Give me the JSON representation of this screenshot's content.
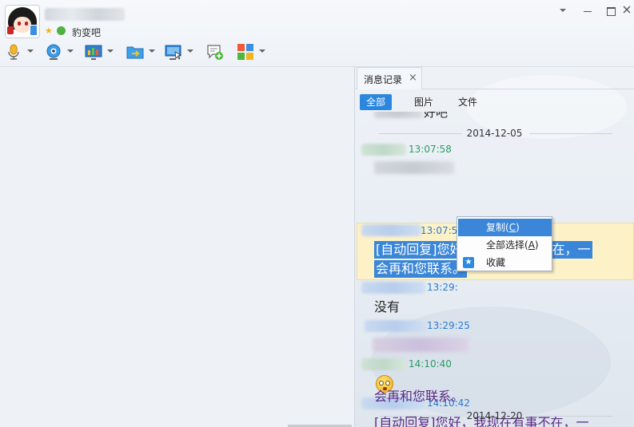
{
  "header": {
    "signature": "豹变吧",
    "icons": [
      "star-icon",
      "mood-icon"
    ],
    "window_controls": [
      "dropdown-icon",
      "minimize-icon",
      "maximize-icon",
      "close-icon"
    ]
  },
  "toolbar": {
    "tools": [
      "voice-call-icon",
      "video-call-icon",
      "screen-share-icon",
      "send-file-icon",
      "remote-assist-icon",
      "new-discussion-icon",
      "apps-icon"
    ]
  },
  "history_panel": {
    "tab_title": "消息记录",
    "close_glyph": "×",
    "filters": [
      "全部",
      "图片",
      "文件"
    ],
    "date_1": "2014-12-05",
    "date_2": "2014-12-20",
    "messages": [
      {
        "time": "13:07:58",
        "sender_color": "green"
      },
      {
        "time": "13:07:59",
        "sender_color": "blue",
        "line1": "[自动回复]您好，我现在有事不在，一",
        "line2": "会再和您联系。"
      },
      {
        "time": "13:29:",
        "sender_color": "blue",
        "text": "没有"
      },
      {
        "time": "13:29:25",
        "sender_color": "blue"
      },
      {
        "time": "14:10:40",
        "sender_color": "green",
        "emoji": "surprised-emoji-icon"
      },
      {
        "time": "14:10:42",
        "sender_color": "blue",
        "line1": "[自动回复]您好，我现在有事不在，一",
        "line2": "会再和您联系。"
      }
    ],
    "partial_top_text": "好吧"
  },
  "context_menu": {
    "items": [
      {
        "label": "复制(",
        "key": "C",
        "tail": ")"
      },
      {
        "label": "全部选择(",
        "key": "A",
        "tail": ")"
      },
      {
        "label": "收藏"
      }
    ]
  },
  "colors": {
    "accent": "#2b86e0",
    "selection": "#3a86d8",
    "time_green": "#2a9d63",
    "time_blue": "#2b7cd3",
    "highlight_bg": "#fdf1c8"
  }
}
